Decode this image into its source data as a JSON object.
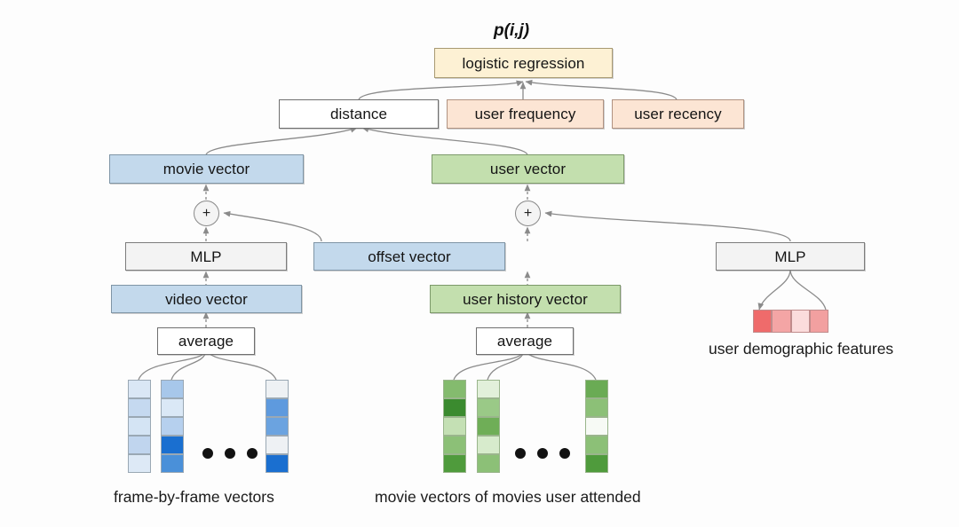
{
  "diagram": {
    "title_label": "p(i,j)",
    "nodes": {
      "logistic_regression": "logistic regression",
      "distance": "distance",
      "user_frequency": "user frequency",
      "user_recency": "user recency",
      "movie_vector": "movie vector",
      "user_vector": "user vector",
      "mlp_left": "MLP",
      "mlp_right": "MLP",
      "offset_vector": "offset vector",
      "video_vector": "video vector",
      "user_history_vector": "user history vector",
      "average_left": "average",
      "average_mid": "average",
      "plus_left": "+",
      "plus_mid": "+"
    },
    "captions": {
      "frame_vectors": "frame-by-frame vectors",
      "movie_vectors": "movie vectors of movies user attended",
      "demographics": "user demographic features"
    },
    "colors": {
      "cream": "#fdf1d4",
      "peach": "#fce5d4",
      "blue": "#c3d9ec",
      "green": "#c3dfae",
      "grey": "#f3f3f3",
      "white": "#ffffff",
      "edge": "#8b8b8b"
    },
    "heatmaps": {
      "frame_columns": [
        {
          "name": "frame-vector-1",
          "cells": [
            "#dae7f5",
            "#c5d9f0",
            "#d4e4f4",
            "#c0d5ee",
            "#dde9f6"
          ]
        },
        {
          "name": "frame-vector-2",
          "cells": [
            "#a7c7ea",
            "#dae8f6",
            "#b6d0ee",
            "#1a6fd0",
            "#4a90d9"
          ]
        },
        {
          "name": "frame-vector-n",
          "cells": [
            "#eef1f4",
            "#5e9ade",
            "#6ba3e0",
            "#eef1f4",
            "#1a6fd0"
          ]
        }
      ],
      "movie_columns": [
        {
          "name": "movie-vector-1",
          "cells": [
            "#84bb6e",
            "#3b8b2f",
            "#c4e0b4",
            "#8cc077",
            "#4f9b3c"
          ]
        },
        {
          "name": "movie-vector-2",
          "cells": [
            "#e2f0da",
            "#9ac987",
            "#6fae57",
            "#d7ebcc",
            "#8cc077"
          ]
        },
        {
          "name": "movie-vector-n",
          "cells": [
            "#6aab54",
            "#8cc077",
            "#f7faf5",
            "#8cc077",
            "#4f9b3c"
          ]
        }
      ],
      "demographic_cells": [
        "#ef6b6b",
        "#f4a5a5",
        "#fbdcdc",
        "#f2a0a0"
      ]
    },
    "ellipsis": "• • •"
  }
}
